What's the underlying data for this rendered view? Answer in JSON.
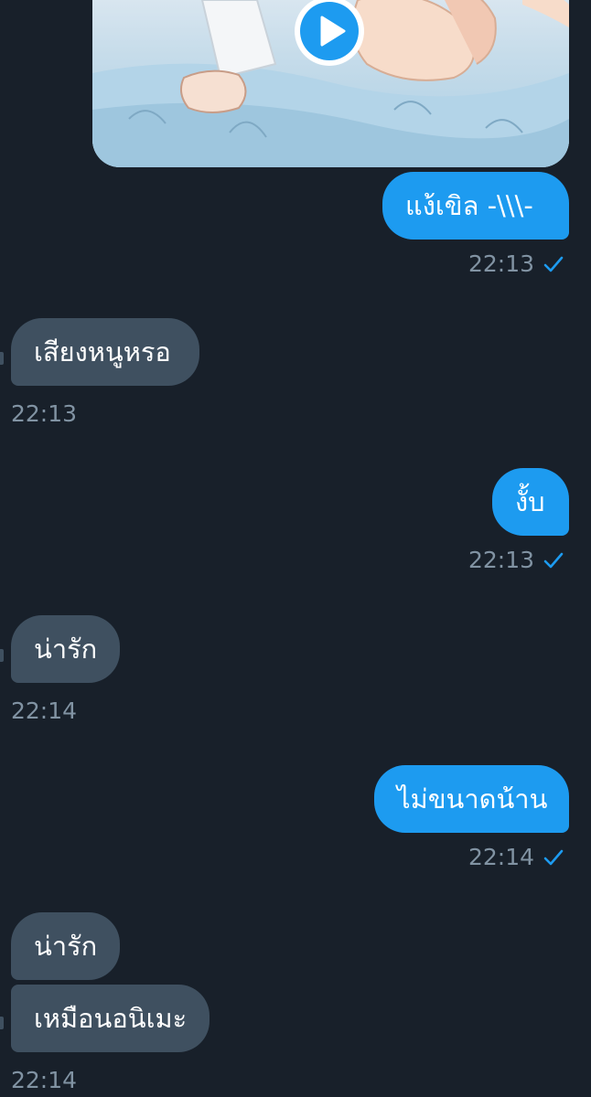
{
  "conversation": {
    "video": {
      "play_icon": "play-icon",
      "thumbnail_style": "anime-bedroom-scene"
    },
    "messages": [
      {
        "id": "m1",
        "direction": "outgoing",
        "text": "แง้เขิล -\\\\\\-",
        "time": "22:13",
        "status_icon": "check-icon"
      },
      {
        "id": "m2",
        "direction": "incoming",
        "text": "เสียงหนูหรอ",
        "time": "22:13"
      },
      {
        "id": "m3",
        "direction": "outgoing",
        "text": "งั้บ",
        "time": "22:13",
        "status_icon": "check-icon"
      },
      {
        "id": "m4",
        "direction": "incoming",
        "text": "น่ารัก",
        "time": "22:14"
      },
      {
        "id": "m5",
        "direction": "outgoing",
        "text": "ไม่ขนาดน้าน",
        "time": "22:14",
        "status_icon": "check-icon"
      },
      {
        "id": "m6",
        "direction": "incoming",
        "text": "น่ารัก"
      },
      {
        "id": "m7",
        "direction": "incoming",
        "text": "เหมือนอนิเมะ",
        "time": "22:14"
      }
    ]
  },
  "colors": {
    "background": "#18202a",
    "outgoing_bubble": "#1d9bf0",
    "incoming_bubble": "#3f5060",
    "timestamp": "#8193a3",
    "check": "#1d9bf0"
  }
}
